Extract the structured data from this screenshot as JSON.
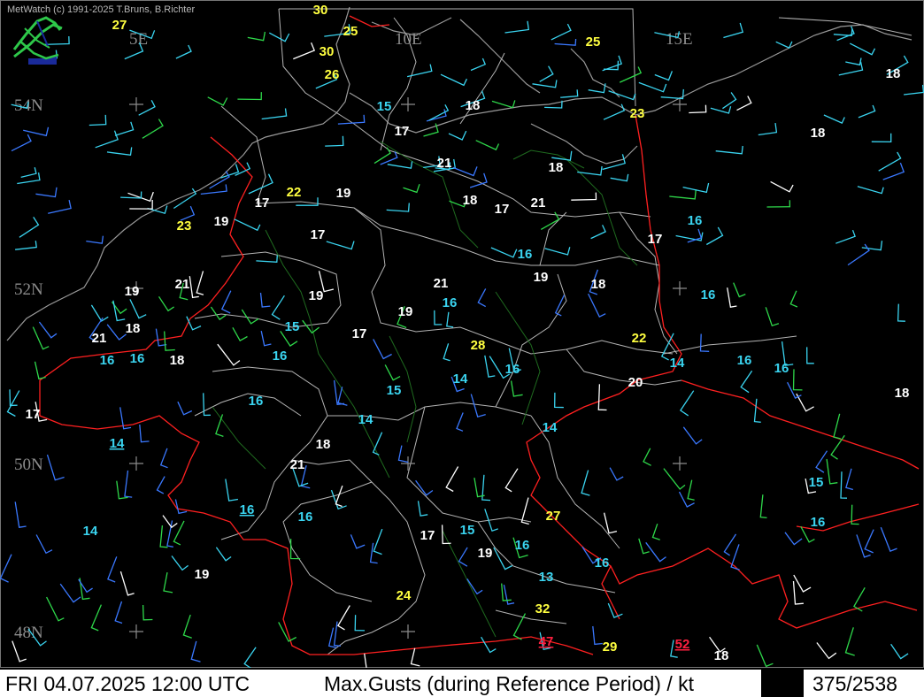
{
  "app": {
    "credit": "MetWatch  (c) 1991-2025 T.Bruns, B.Richter"
  },
  "footer": {
    "datetime": "FRI 04.07.2025 12:00 UTC",
    "title": "Max.Gusts (during Reference Period) / kt",
    "count": "375/2538"
  },
  "grid_labels": {
    "lon": [
      "5E",
      "10E",
      "15E"
    ],
    "lat": [
      "54N",
      "52N",
      "50N",
      "48N"
    ]
  },
  "colors": {
    "background": "#000000",
    "border": "#ff2020",
    "coast": "#9a9a9a",
    "region": "#b4b4b4",
    "river": "#1f6b1f",
    "white_values": "#ffffff",
    "cyan_values": "#3ad4f0",
    "yellow_values": "#ffff40",
    "red_values": "#ff2040"
  },
  "icons": [
    "metwatch-logo-icon",
    "grid-cross-icon",
    "wind-barb-icon"
  ],
  "observations": [
    {
      "value": "27",
      "color": "yellow"
    },
    {
      "value": "30",
      "color": "yellow"
    },
    {
      "value": "25",
      "color": "yellow"
    },
    {
      "value": "30",
      "color": "yellow"
    },
    {
      "value": "26",
      "color": "yellow"
    },
    {
      "value": "25",
      "color": "yellow"
    },
    {
      "value": "15",
      "color": "cyan"
    },
    {
      "value": "18",
      "color": "white"
    },
    {
      "value": "23",
      "color": "yellow"
    },
    {
      "value": "18",
      "color": "white"
    },
    {
      "value": "17",
      "color": "white"
    },
    {
      "value": "21",
      "color": "white"
    },
    {
      "value": "18",
      "color": "white"
    },
    {
      "value": "18",
      "color": "white"
    },
    {
      "value": "22",
      "color": "yellow"
    },
    {
      "value": "19",
      "color": "white"
    },
    {
      "value": "17",
      "color": "white"
    },
    {
      "value": "18",
      "color": "white"
    },
    {
      "value": "17",
      "color": "white"
    },
    {
      "value": "21",
      "color": "white"
    },
    {
      "value": "19",
      "color": "white"
    },
    {
      "value": "23",
      "color": "yellow"
    },
    {
      "value": "16",
      "color": "cyan"
    },
    {
      "value": "17",
      "color": "white"
    },
    {
      "value": "17",
      "color": "white"
    },
    {
      "value": "16",
      "color": "cyan"
    },
    {
      "value": "19",
      "color": "white"
    },
    {
      "value": "21",
      "color": "white"
    },
    {
      "value": "21",
      "color": "white"
    },
    {
      "value": "19",
      "color": "white"
    },
    {
      "value": "18",
      "color": "white"
    },
    {
      "value": "19",
      "color": "white"
    },
    {
      "value": "16",
      "color": "cyan"
    },
    {
      "value": "16",
      "color": "cyan"
    },
    {
      "value": "19",
      "color": "white"
    },
    {
      "value": "18",
      "color": "white"
    },
    {
      "value": "15",
      "color": "cyan"
    },
    {
      "value": "17",
      "color": "white"
    },
    {
      "value": "21",
      "color": "white"
    },
    {
      "value": "22",
      "color": "yellow"
    },
    {
      "value": "28",
      "color": "yellow"
    },
    {
      "value": "16",
      "color": "cyan"
    },
    {
      "value": "16",
      "color": "cyan"
    },
    {
      "value": "14",
      "color": "cyan"
    },
    {
      "value": "16",
      "color": "cyan"
    },
    {
      "value": "18",
      "color": "white"
    },
    {
      "value": "16",
      "color": "cyan"
    },
    {
      "value": "16",
      "color": "cyan"
    },
    {
      "value": "15",
      "color": "cyan"
    },
    {
      "value": "14",
      "color": "cyan"
    },
    {
      "value": "20",
      "color": "white"
    },
    {
      "value": "18",
      "color": "white"
    },
    {
      "value": "17",
      "color": "white"
    },
    {
      "value": "16",
      "color": "cyan"
    },
    {
      "value": "16",
      "color": "cyan"
    },
    {
      "value": "14",
      "color": "cyan"
    },
    {
      "value": "14",
      "color": "cyan"
    },
    {
      "value": "14",
      "color": "cyan",
      "underline": true
    },
    {
      "value": "18",
      "color": "white"
    },
    {
      "value": "21",
      "color": "white"
    },
    {
      "value": "15",
      "color": "cyan"
    },
    {
      "value": "16",
      "color": "cyan",
      "underline": true
    },
    {
      "value": "16",
      "color": "cyan"
    },
    {
      "value": "27",
      "color": "yellow"
    },
    {
      "value": "16",
      "color": "cyan"
    },
    {
      "value": "14",
      "color": "cyan"
    },
    {
      "value": "17",
      "color": "white"
    },
    {
      "value": "15",
      "color": "cyan"
    },
    {
      "value": "16",
      "color": "cyan"
    },
    {
      "value": "19",
      "color": "white"
    },
    {
      "value": "16",
      "color": "cyan"
    },
    {
      "value": "19",
      "color": "white"
    },
    {
      "value": "13",
      "color": "cyan"
    },
    {
      "value": "24",
      "color": "yellow"
    },
    {
      "value": "32",
      "color": "yellow"
    },
    {
      "value": "47",
      "color": "red",
      "underline": true
    },
    {
      "value": "29",
      "color": "yellow"
    },
    {
      "value": "52",
      "color": "red",
      "underline": true
    },
    {
      "value": "18",
      "color": "white"
    }
  ]
}
